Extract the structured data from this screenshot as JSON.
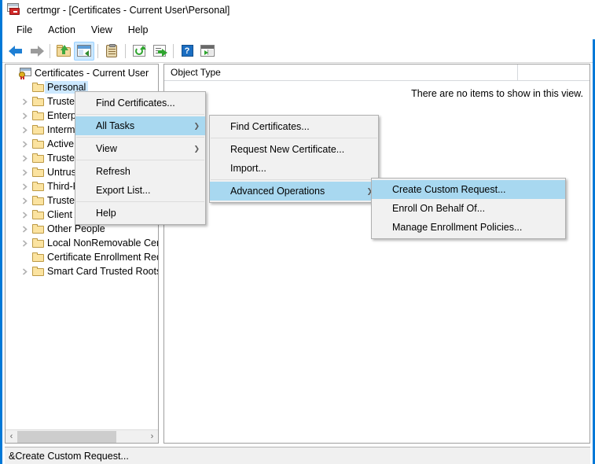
{
  "window": {
    "title": "certmgr - [Certificates - Current User\\Personal]",
    "icon": "certmgr-icon",
    "accent_color": "#0078d7"
  },
  "menubar": {
    "items": [
      {
        "label": "File",
        "name": "menubar-item-file"
      },
      {
        "label": "Action",
        "name": "menubar-item-action"
      },
      {
        "label": "View",
        "name": "menubar-item-view"
      },
      {
        "label": "Help",
        "name": "menubar-item-help"
      }
    ]
  },
  "toolbar": {
    "buttons": [
      {
        "icon": "back-arrow-icon",
        "name": "toolbar-back"
      },
      {
        "icon": "forward-arrow-icon",
        "name": "toolbar-forward"
      },
      {
        "icon": "up-one-level-icon",
        "name": "toolbar-up-one-level"
      },
      {
        "icon": "show-hide-console-tree-icon",
        "name": "toolbar-show-hide-tree"
      },
      {
        "icon": "properties-icon",
        "name": "toolbar-properties"
      },
      {
        "icon": "refresh-icon",
        "name": "toolbar-refresh"
      },
      {
        "icon": "export-list-icon",
        "name": "toolbar-export-list"
      },
      {
        "icon": "help-icon",
        "name": "toolbar-help",
        "glyph": "?"
      },
      {
        "icon": "show-hide-action-pane-icon",
        "name": "toolbar-action-pane"
      }
    ]
  },
  "tree": {
    "root": {
      "label": "Certificates - Current User",
      "icon": "certificate-store-icon"
    },
    "items": [
      {
        "label": "Personal",
        "expandable": false,
        "selected": true
      },
      {
        "label": "Trusted Root Certification Authorities",
        "expandable": true,
        "selected": false
      },
      {
        "label": "Enterprise Trust",
        "expandable": true,
        "selected": false
      },
      {
        "label": "Intermediate Certification Authorities",
        "expandable": true,
        "selected": false
      },
      {
        "label": "Active Directory User Object",
        "expandable": true,
        "selected": false
      },
      {
        "label": "Trusted Publishers",
        "expandable": true,
        "selected": false
      },
      {
        "label": "Untrusted Certificates",
        "expandable": true,
        "selected": false
      },
      {
        "label": "Third-Party Root Certification Authorities",
        "expandable": true,
        "selected": false
      },
      {
        "label": "Trusted People",
        "expandable": true,
        "selected": false
      },
      {
        "label": "Client Authentication Issuers",
        "expandable": true,
        "selected": false
      },
      {
        "label": "Other People",
        "expandable": true,
        "selected": false
      },
      {
        "label": "Local NonRemovable Certificates",
        "expandable": true,
        "selected": false
      },
      {
        "label": "Certificate Enrollment Requests",
        "expandable": false,
        "selected": false
      },
      {
        "label": "Smart Card Trusted Roots",
        "expandable": true,
        "selected": false
      }
    ],
    "scrollbar": {
      "left_glyph": "‹",
      "right_glyph": "›"
    }
  },
  "list_pane": {
    "columns": [
      "Object Type"
    ],
    "empty_message": "There are no items to show in this view."
  },
  "context_menu_1": {
    "name": "personal-context-menu",
    "items": [
      {
        "label": "Find Certificates...",
        "highlighted": false,
        "submenu": false
      },
      {
        "separator": true
      },
      {
        "label": "All Tasks",
        "highlighted": true,
        "submenu": true
      },
      {
        "separator": true
      },
      {
        "label": "View",
        "highlighted": false,
        "submenu": true
      },
      {
        "separator": true
      },
      {
        "label": "Refresh",
        "highlighted": false,
        "submenu": false
      },
      {
        "label": "Export List...",
        "highlighted": false,
        "submenu": false
      },
      {
        "separator": true
      },
      {
        "label": "Help",
        "highlighted": false,
        "submenu": false
      }
    ]
  },
  "context_menu_2": {
    "name": "all-tasks-submenu",
    "items": [
      {
        "label": "Find Certificates...",
        "highlighted": false,
        "submenu": false
      },
      {
        "separator": true
      },
      {
        "label": "Request New Certificate...",
        "highlighted": false,
        "submenu": false
      },
      {
        "label": "Import...",
        "highlighted": false,
        "submenu": false
      },
      {
        "separator": true
      },
      {
        "label": "Advanced Operations",
        "highlighted": true,
        "submenu": true
      }
    ]
  },
  "context_menu_3": {
    "name": "advanced-operations-submenu",
    "items": [
      {
        "label": "Create Custom Request...",
        "highlighted": true,
        "submenu": false
      },
      {
        "label": "Enroll On Behalf Of...",
        "highlighted": false,
        "submenu": false
      },
      {
        "label": "Manage Enrollment Policies...",
        "highlighted": false,
        "submenu": false
      }
    ]
  },
  "statusbar": {
    "text": "&Create Custom Request..."
  },
  "colors": {
    "menu_highlight": "#a8d8f0",
    "tree_selection": "#cce8ff",
    "window_border": "#0078d7"
  }
}
